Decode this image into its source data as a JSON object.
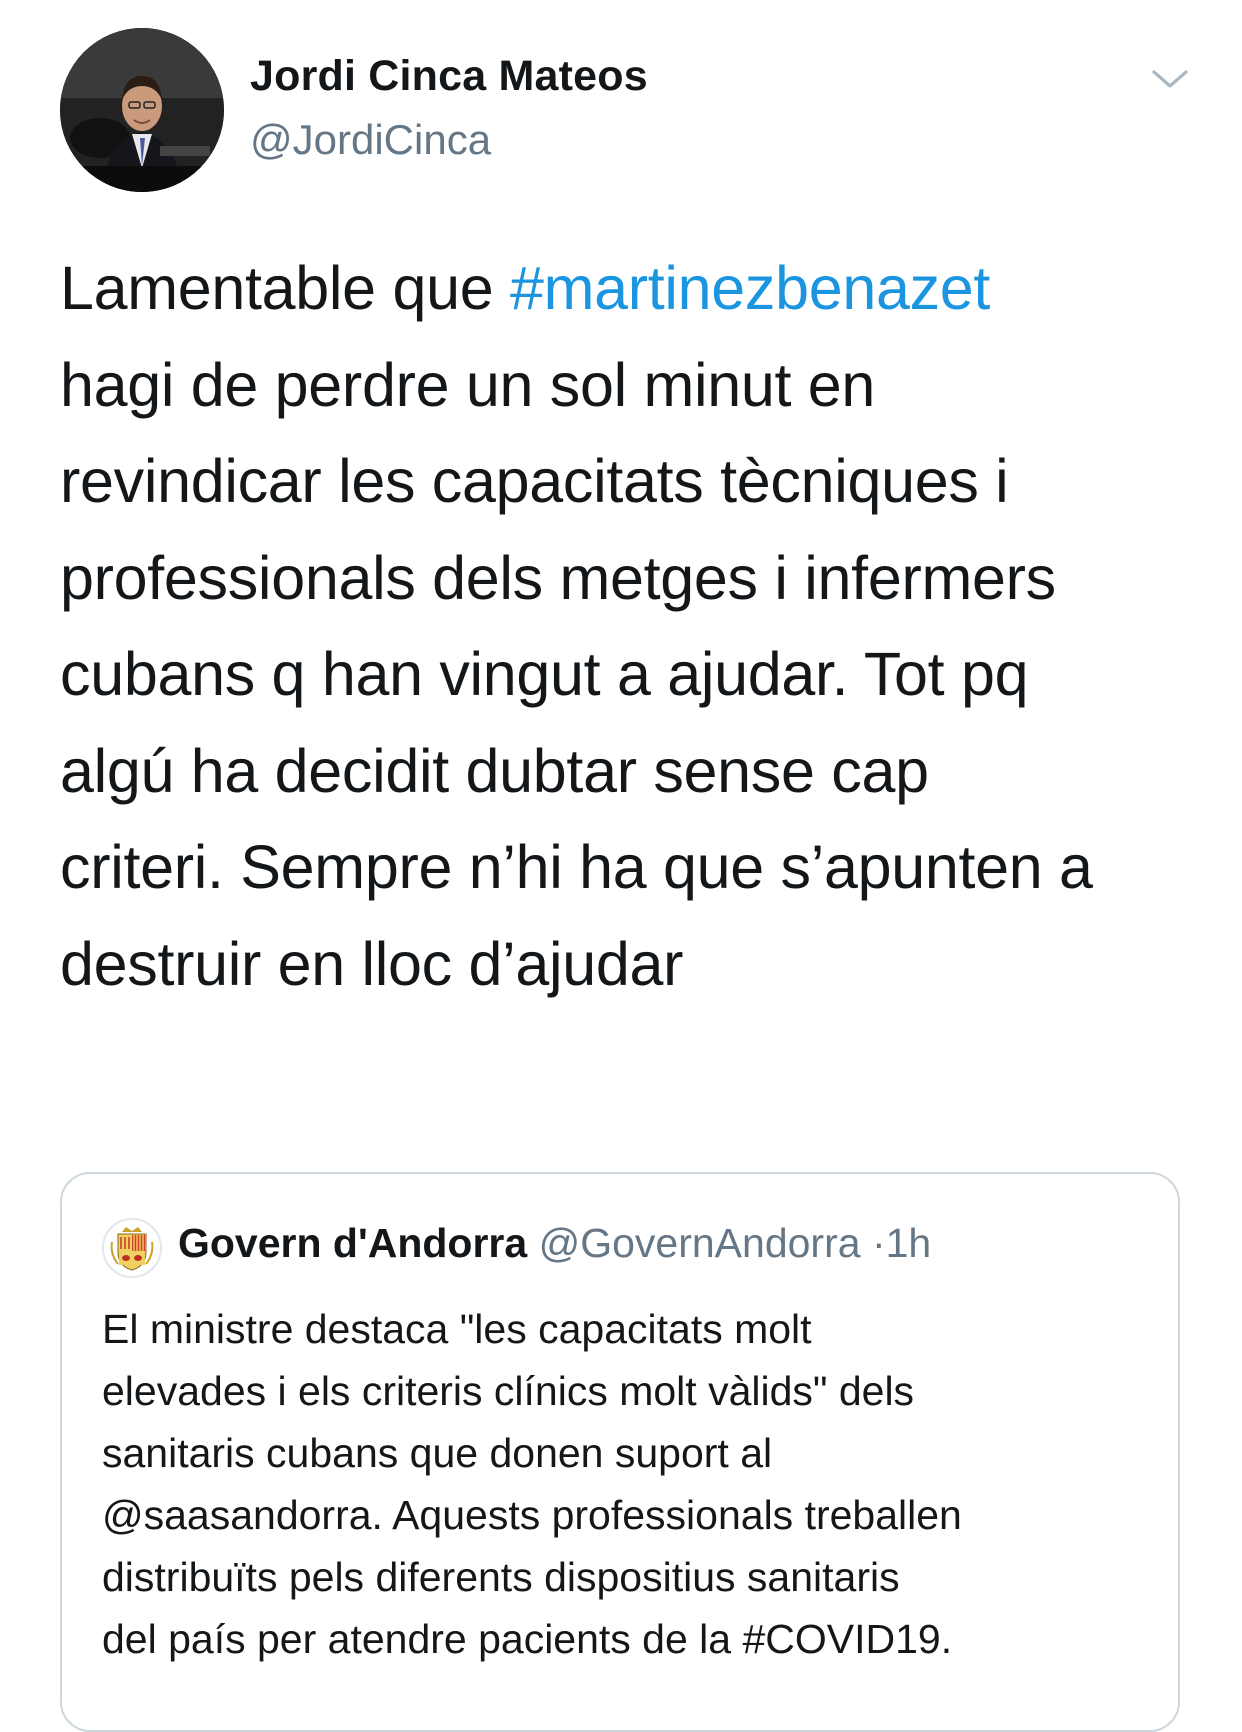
{
  "tweet": {
    "author_name": "Jordi Cinca Mateos",
    "author_handle": "@JordiCinca",
    "text_lines": [
      {
        "before": "Lamentable que ",
        "hashtag": "#martinezbenazet",
        "after": ""
      },
      {
        "before": "hagi de perdre un sol minut en",
        "hashtag": "",
        "after": ""
      },
      {
        "before": "revindicar les capacitats tècniques i",
        "hashtag": "",
        "after": ""
      },
      {
        "before": "professionals dels metges i infermers",
        "hashtag": "",
        "after": ""
      },
      {
        "before": "cubans q han vingut a ajudar. Tot pq",
        "hashtag": "",
        "after": ""
      },
      {
        "before": "algú ha decidit dubtar sense cap",
        "hashtag": "",
        "after": ""
      },
      {
        "before": "criteri. Sempre n’hi ha que s’apunten a",
        "hashtag": "",
        "after": ""
      },
      {
        "before": "destruir en lloc d’ajudar",
        "hashtag": "",
        "after": ""
      }
    ]
  },
  "quoted_tweet": {
    "author_name": "Govern d'Andorra",
    "author_handle": "@GovernAndorra",
    "separator": "·",
    "timestamp": "1h",
    "text_lines": [
      "El ministre destaca \"les capacitats molt",
      "elevades i els criteris clínics molt vàlids\" dels",
      "sanitaris cubans que donen suport al",
      "@saasandorra. Aquests professionals treballen",
      "distribuïts pels diferents dispositius sanitaris",
      "del país per atendre pacients de la #COVID19."
    ]
  },
  "icons": {
    "more": "chevron-down-icon",
    "avatar": "profile-photo",
    "quote_avatar": "andorra-coat-of-arms"
  },
  "colors": {
    "text": "#14171a",
    "secondary": "#657786",
    "hashtag": "#1b95e0",
    "border": "#ccd6dd"
  }
}
